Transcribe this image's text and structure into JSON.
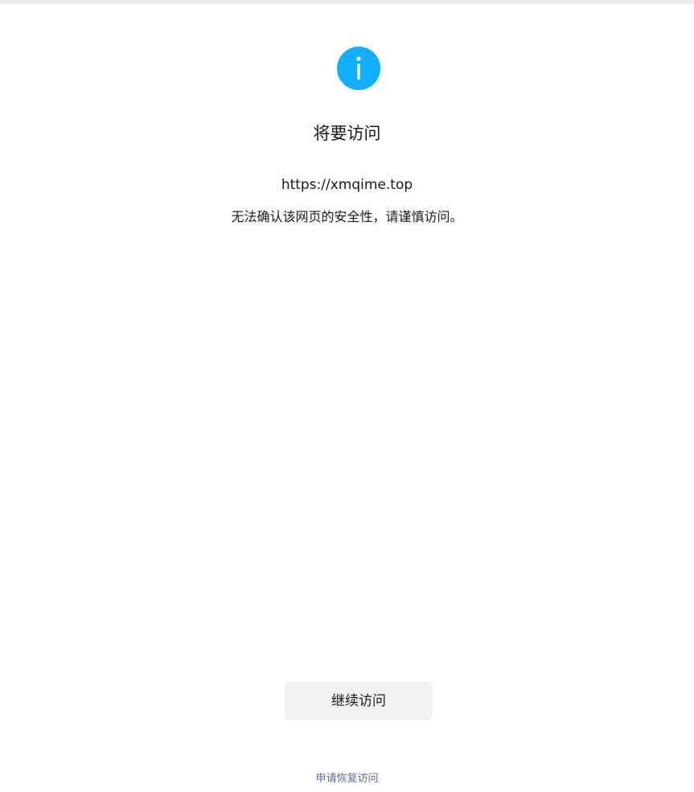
{
  "icon": {
    "name": "info-icon",
    "color": "#10aeff"
  },
  "page": {
    "title": "将要访问",
    "url": "https://xmqime.top",
    "warning": "无法确认该网页的安全性，请谨慎访问。"
  },
  "actions": {
    "continue_label": "继续访问",
    "restore_label": "申请恢复访问"
  },
  "colors": {
    "accent": "#10aeff",
    "link": "#576b95",
    "button_bg": "#f2f2f2",
    "text": "#191919"
  }
}
